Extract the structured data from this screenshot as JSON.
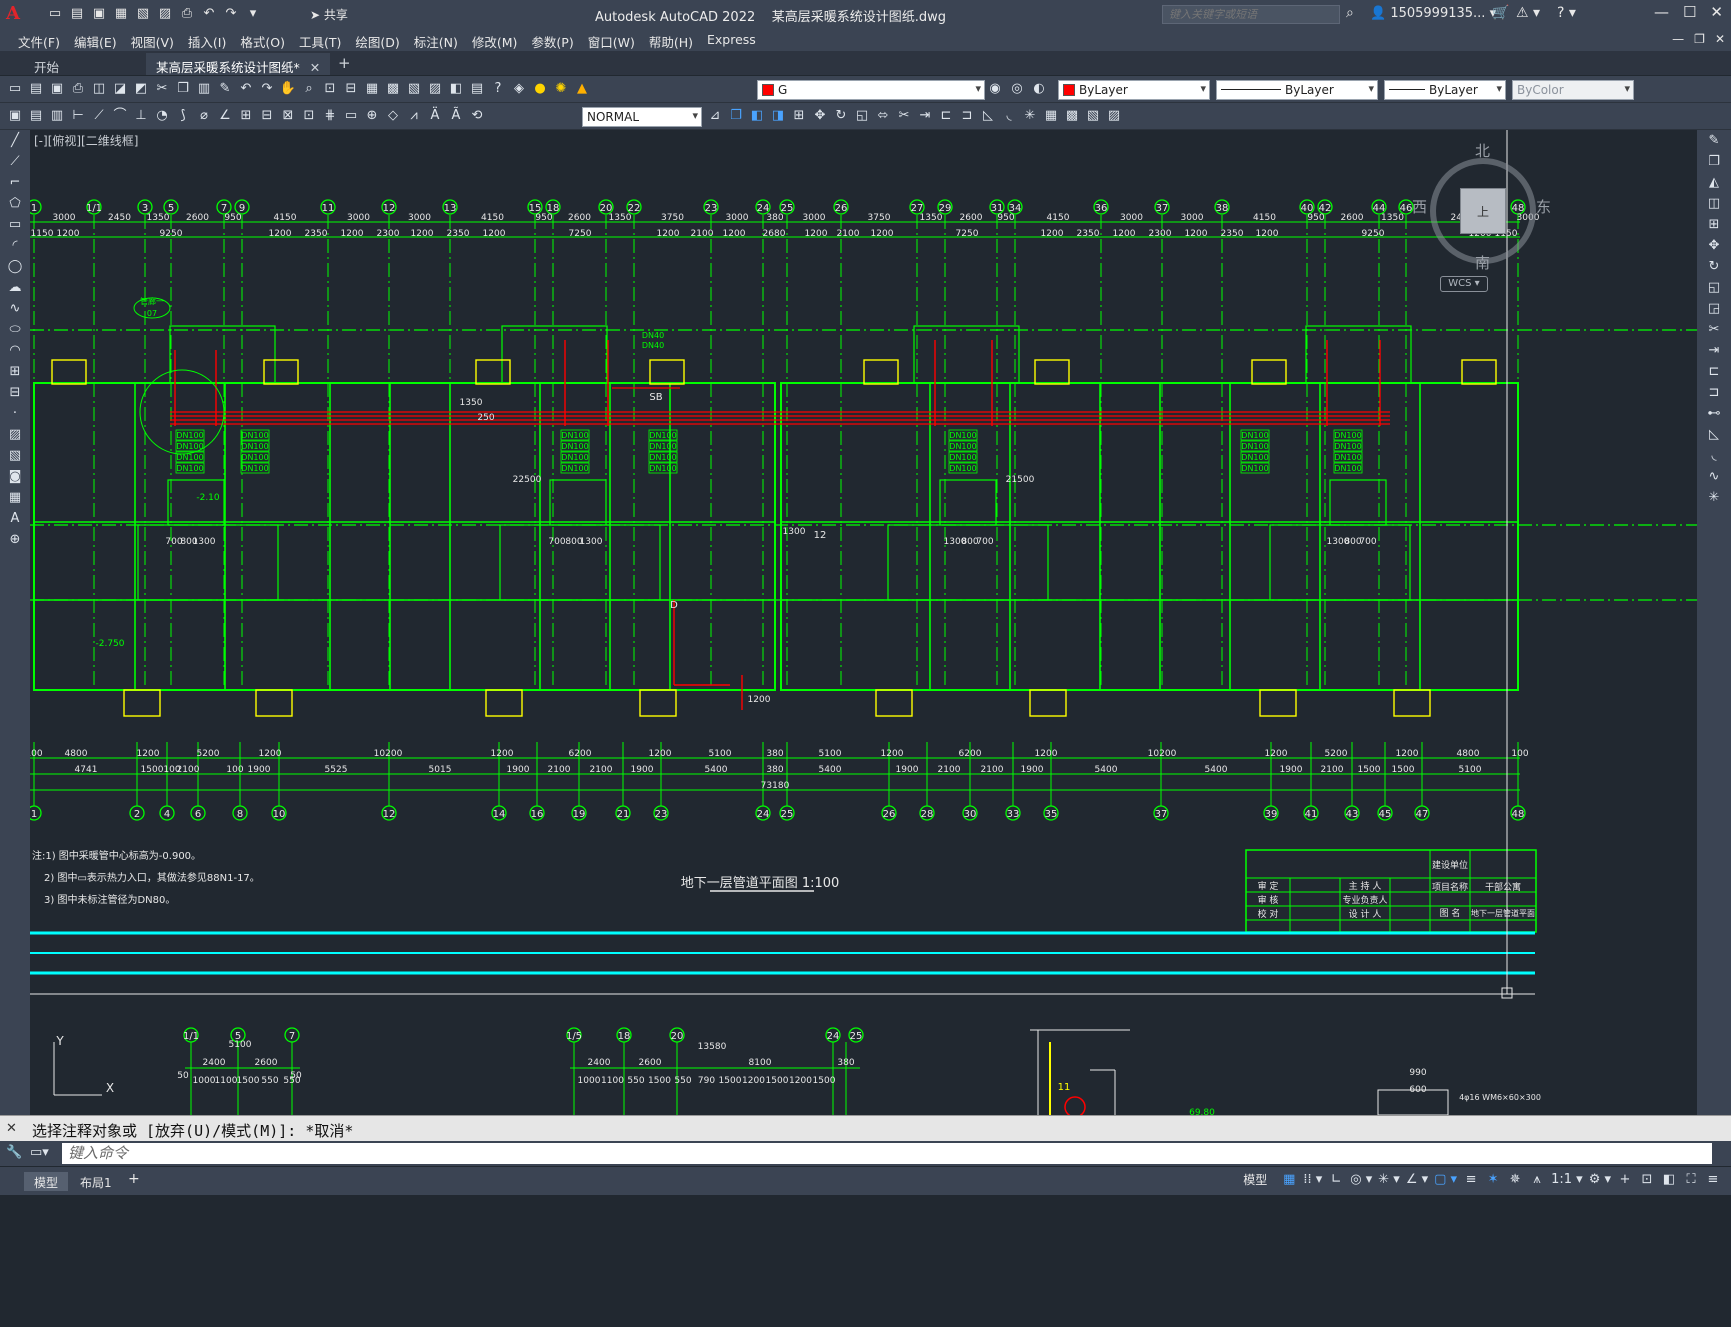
{
  "window": {
    "app_name": "Autodesk AutoCAD 2022",
    "file_name": "某高层采暖系统设计图纸.dwg",
    "share_label": "共享",
    "search_placeholder": "键入关键字或短语",
    "user": "1505999135...",
    "minimize": "—",
    "maximize": "☐",
    "close": "✕"
  },
  "menu": [
    "文件(F)",
    "编辑(E)",
    "视图(V)",
    "插入(I)",
    "格式(O)",
    "工具(T)",
    "绘图(D)",
    "标注(N)",
    "修改(M)",
    "参数(P)",
    "窗口(W)",
    "帮助(H)",
    "Express"
  ],
  "tabs": [
    {
      "label": "开始"
    },
    {
      "label": "某高层采暖系统设计图纸*"
    }
  ],
  "toolbar": {
    "layer": "G",
    "color": "ByLayer",
    "linetype": "ByLayer",
    "lineweight": "ByLayer",
    "plotstyle": "ByColor",
    "dimstyle": "NORMAL"
  },
  "viewport": {
    "view_label": "[-][俯视][二维线框]",
    "navcube_north": "北",
    "navcube_south": "南",
    "navcube_east": "东",
    "navcube_west": "西",
    "navcube_face": "上",
    "wcs": "WCS"
  },
  "drawing": {
    "top_axis_labels": [
      "1",
      "1/1",
      "3",
      "5",
      "7",
      "9",
      "11",
      "12",
      "13",
      "15",
      "18",
      "20",
      "22",
      "23",
      "24",
      "25",
      "26",
      "27",
      "29",
      "31",
      "34",
      "36",
      "37",
      "38",
      "40",
      "42",
      "44",
      "46",
      "48"
    ],
    "top_dims_row1": [
      "3000",
      "2450",
      "1350",
      "2600",
      "950",
      "4150",
      "3000",
      "3000",
      "4150",
      "950",
      "2600",
      "1350",
      "3750",
      "3000",
      "380",
      "3000",
      "3750",
      "1350",
      "2600",
      "950",
      "4150",
      "3000",
      "3000",
      "4150",
      "950",
      "2600",
      "1350",
      "2450",
      "3000"
    ],
    "top_dims_row2": [
      "1150",
      "1200",
      "9250",
      "1200",
      "2350",
      "1200",
      "2300",
      "1200",
      "2350",
      "1200",
      "7250",
      "1200",
      "2100",
      "1200",
      "2680",
      "1200",
      "2100",
      "1200",
      "7250",
      "1200",
      "2350",
      "1200",
      "2300",
      "1200",
      "2350",
      "1200",
      "9250",
      "1200",
      "1150"
    ],
    "bottom_dims_row1": [
      "100",
      "4800",
      "1200",
      "5200",
      "1200",
      "10200",
      "1200",
      "6200",
      "1200",
      "5100",
      "380",
      "5100",
      "1200",
      "6200",
      "1200",
      "10200",
      "1200",
      "5200",
      "1200",
      "4800",
      "100"
    ],
    "bottom_dims_row2": [
      "4741",
      "1500",
      "100",
      "2100",
      "100",
      "1900",
      "5525",
      "5015",
      "1900",
      "2100",
      "2100",
      "1900",
      "5400",
      "380",
      "5400",
      "1900",
      "2100",
      "2100",
      "1900",
      "5400",
      "5400",
      "1900",
      "2100",
      "1500",
      "1500",
      "5100"
    ],
    "bottom_total": "73180",
    "bottom_axis_labels": [
      "1",
      "2",
      "4",
      "6",
      "8",
      "10",
      "12",
      "14",
      "16",
      "19",
      "21",
      "23",
      "24",
      "25",
      "26",
      "28",
      "30",
      "33",
      "35",
      "37",
      "39",
      "41",
      "43",
      "45",
      "47",
      "48"
    ],
    "pipe_labels": [
      "DN100",
      "DN100",
      "DN100",
      "DN100"
    ],
    "pipe_label_dn40": "DN40",
    "dim_22500": "22500",
    "dim_21500": "21500",
    "elev_210": "-2.10",
    "elev_2750": "-2.750",
    "dim_250": "250",
    "dim_1350": "1350",
    "label_sb": "SB",
    "label_d": "D",
    "label_12": "12",
    "dim_1300": "1300",
    "dim_1200": "1200",
    "unit_dims_left": [
      "700",
      "800",
      "1300"
    ],
    "unit_dims_right": [
      "1300",
      "800",
      "700"
    ],
    "leader_label": "管廊一",
    "leader_sub": "07",
    "notes": [
      "注:1) 图中采暖管中心标高为-0.900。",
      "2) 图中▭表示热力入口，其做法参见88N1-17。",
      "3) 图中未标注管径为DN80。"
    ],
    "drawing_title": "地下一层管道平面图",
    "drawing_scale": "1:100",
    "titleblock": {
      "design_unit": "建设单位",
      "project_name_label": "项目名称",
      "project_name": "干部公寓",
      "drawing_name_label": "图 名",
      "drawing_name": "地下一层管道平面",
      "rows": [
        [
          "审 定",
          "主 持 人"
        ],
        [
          "审 核",
          "专业负责人"
        ],
        [
          "校 对",
          "设 计 人"
        ]
      ]
    },
    "lower_labels": [
      "1/1",
      "5",
      "7",
      "1/5",
      "18",
      "20",
      "24",
      "25"
    ],
    "lower_dims": [
      "5100",
      "2400",
      "2600",
      "13580",
      "2400",
      "2600",
      "8100",
      "380",
      "990",
      "600",
      "69.80",
      "50",
      "50",
      "11"
    ],
    "lower_row_dims_left": [
      "1000",
      "1100",
      "1500",
      "550"
    ],
    "lower_row_dims_right": [
      "1000",
      "1100",
      "550",
      "1500",
      "550",
      "790",
      "1500",
      "1200",
      "1500",
      "1200",
      "1500"
    ],
    "lower_right_note": "4φ16 WM6×60×300"
  },
  "command": {
    "history": "选择注释对象或 [放弃(U)/模式(M)]: *取消*",
    "placeholder": "键入命令"
  },
  "status": {
    "tabs": [
      "模型",
      "布局1"
    ],
    "model_label": "模型",
    "scale": "1:1"
  },
  "colors": {
    "accent_green": "#00ff00",
    "pipe_red": "#ff0000",
    "cyan": "#00ffff",
    "yellow": "#ffff00",
    "background": "#212830"
  }
}
